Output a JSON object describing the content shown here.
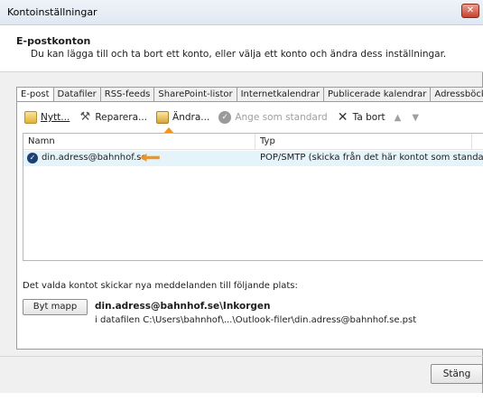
{
  "window": {
    "title": "Kontoinställningar"
  },
  "header": {
    "title": "E-postkonton",
    "description": "Du kan lägga till och ta bort ett konto, eller välja ett konto och ändra dess inställningar."
  },
  "tabs": [
    {
      "label": "E-post",
      "active": true
    },
    {
      "label": "Datafiler"
    },
    {
      "label": "RSS-feeds"
    },
    {
      "label": "SharePoint-listor"
    },
    {
      "label": "Internetkalendrar"
    },
    {
      "label": "Publicerade kalendrar"
    },
    {
      "label": "Adressböcker"
    }
  ],
  "toolbar": {
    "new_label": "Nytt...",
    "repair_label": "Reparera...",
    "change_label": "Ändra...",
    "set_default_label": "Ange som standard",
    "remove_label": "Ta bort",
    "up_icon": "arrow-up-icon",
    "down_icon": "arrow-down-icon"
  },
  "accounts_list": {
    "columns": {
      "name": "Namn",
      "type": "Typ"
    },
    "rows": [
      {
        "name": "din.adress@bahnhof.se",
        "type": "POP/SMTP (skicka från det här kontot som standard)"
      }
    ]
  },
  "delivery": {
    "info": "Det valda kontot skickar nya meddelanden till följande plats:",
    "change_folder_label": "Byt mapp",
    "folder_path": "din.adress@bahnhof.se\\Inkorgen",
    "datafile_path": "i datafilen C:\\Users\\bahnhof\\...\\Outlook-filer\\din.adress@bahnhof.se.pst"
  },
  "footer": {
    "close_label": "Stäng"
  },
  "colors": {
    "annotation_arrow": "#f0951e",
    "selection": "#e5f3fb",
    "default_badge": "#1d3f73"
  }
}
